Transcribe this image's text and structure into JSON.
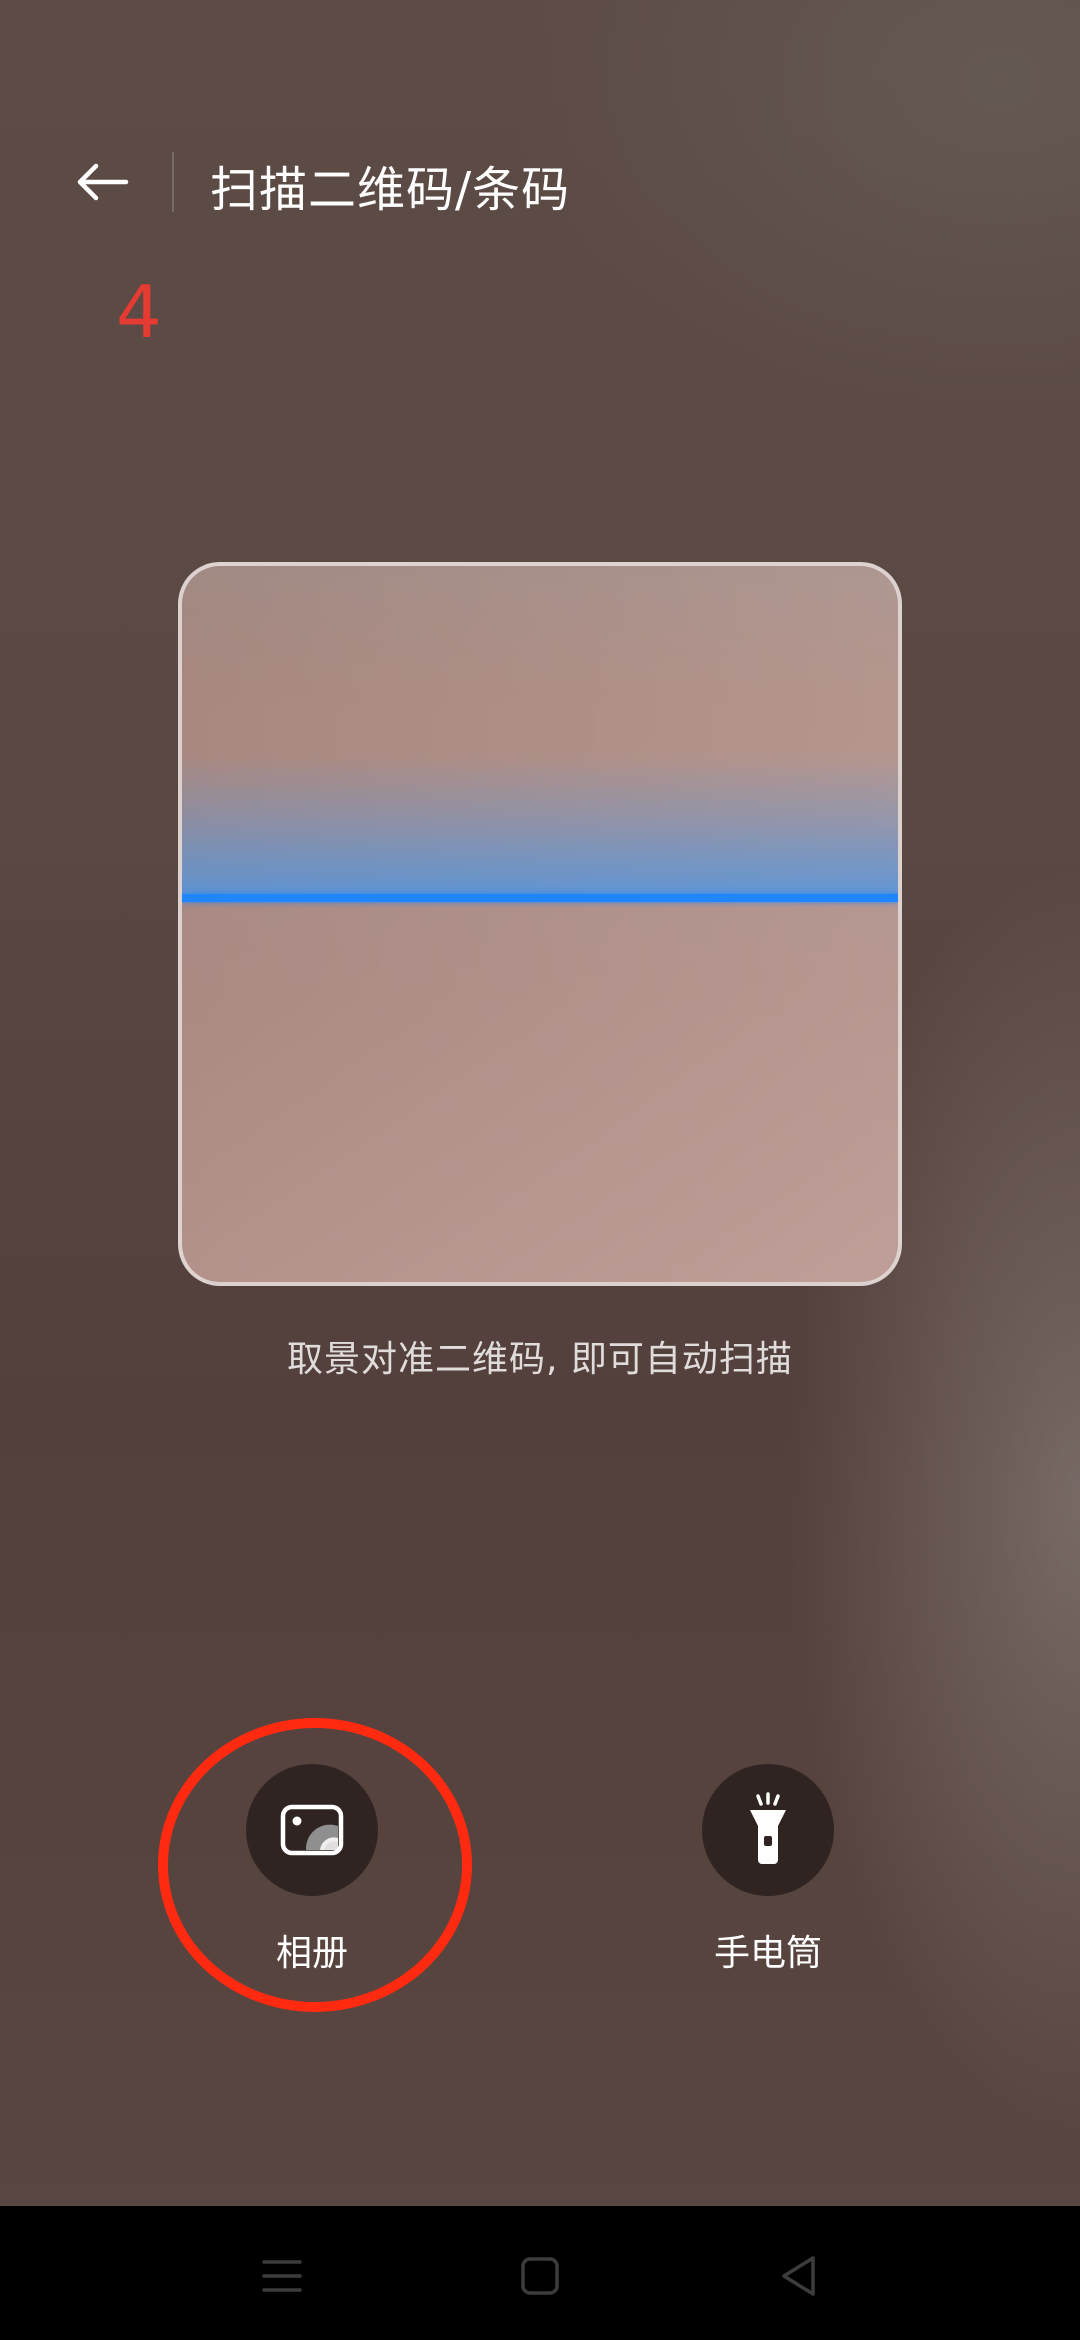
{
  "header": {
    "title": "扫描二维码/条码",
    "back_icon": "arrow-left-icon"
  },
  "annotation": {
    "step_number": "4",
    "color": "#e53b32",
    "highlight_color": "#ff2a10"
  },
  "scanner": {
    "hint": "取景对准二维码, 即可自动扫描",
    "scan_line_color": "#1f86ff"
  },
  "actions": {
    "album": {
      "label": "相册",
      "icon": "photo-album-icon"
    },
    "flashlight": {
      "label": "手电筒",
      "icon": "flashlight-icon"
    }
  },
  "nav_bar": {
    "items": [
      {
        "icon": "menu-icon"
      },
      {
        "icon": "home-square-icon"
      },
      {
        "icon": "back-triangle-icon"
      }
    ]
  }
}
